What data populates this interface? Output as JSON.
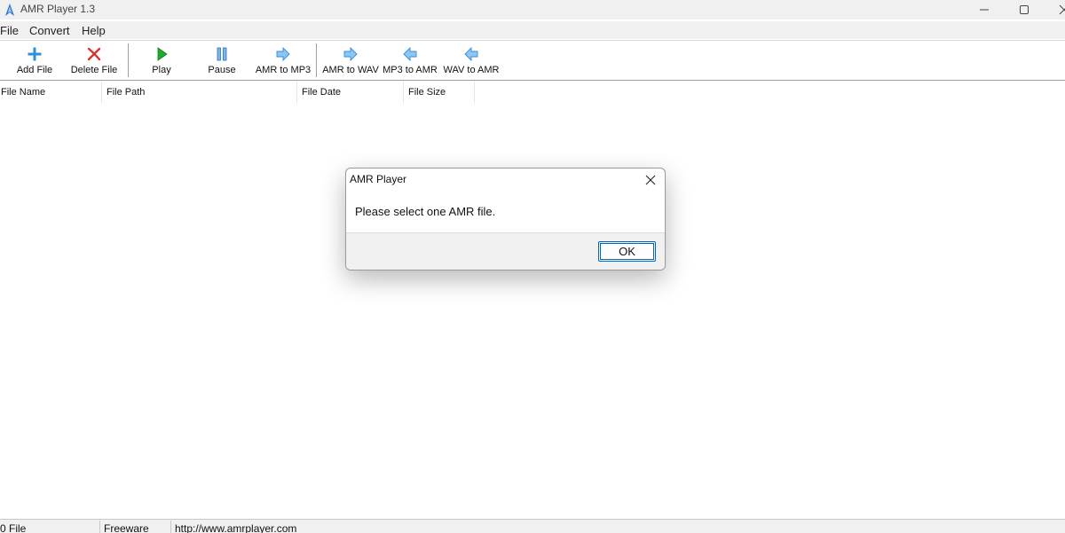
{
  "window": {
    "title": "AMR Player 1.3"
  },
  "menu": [
    "File",
    "Convert",
    "Help"
  ],
  "toolbar": {
    "add_file": "Add File",
    "delete_file": "Delete File",
    "play": "Play",
    "pause": "Pause",
    "amr_to_mp3": "AMR to MP3",
    "amr_to_wav": "AMR to WAV",
    "mp3_to_amr": "MP3 to AMR",
    "wav_to_amr": "WAV to AMR"
  },
  "columns": [
    "File Name",
    "File Path",
    "File Date",
    "File Size"
  ],
  "status": {
    "count": "0 File",
    "license": "Freeware",
    "url": "http://www.amrplayer.com"
  },
  "dialog": {
    "title": "AMR Player",
    "message": "Please select one AMR file.",
    "ok_label": "OK"
  },
  "icons": {
    "app": "amr-player-app-icon",
    "add": "plus-icon",
    "delete": "red-x-icon",
    "play": "green-play-icon",
    "pause": "blue-pause-icon",
    "convert_right": "blue-arrow-right-icon",
    "convert_left": "blue-arrow-left-icon"
  },
  "colors": {
    "accent": "#0067c0",
    "add_icon": "#2f8fd8",
    "delete_icon": "#d9342b",
    "play_icon": "#1faa2c",
    "convert_icon": "#52a8e8"
  }
}
